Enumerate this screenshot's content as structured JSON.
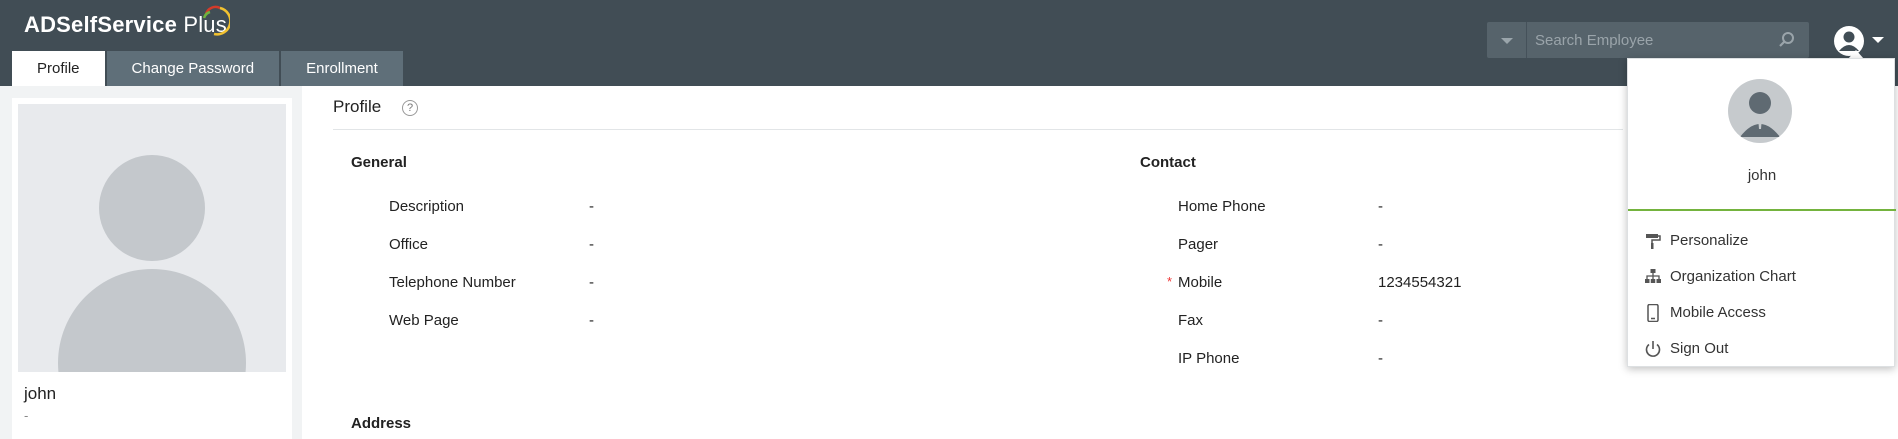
{
  "app": {
    "logo_text": "ADSelfService",
    "logo_plus": "Plus"
  },
  "tabs": [
    {
      "label": "Profile",
      "active": true
    },
    {
      "label": "Change Password",
      "active": false
    },
    {
      "label": "Enrollment",
      "active": false
    }
  ],
  "search": {
    "placeholder": "Search Employee",
    "value": ""
  },
  "profile_card": {
    "name": "john",
    "subtitle": "-"
  },
  "main": {
    "title": "Profile",
    "help_glyph": "?",
    "general": {
      "title": "General",
      "fields": [
        {
          "label": "Description",
          "value": "-"
        },
        {
          "label": "Office",
          "value": "-"
        },
        {
          "label": "Telephone Number",
          "value": "-"
        },
        {
          "label": "Web Page",
          "value": "-"
        }
      ]
    },
    "contact": {
      "title": "Contact",
      "fields": [
        {
          "label": "Home Phone",
          "value": "-",
          "required": false
        },
        {
          "label": "Pager",
          "value": "-",
          "required": false
        },
        {
          "label": "Mobile",
          "value": "1234554321",
          "required": true
        },
        {
          "label": "Fax",
          "value": "-",
          "required": false
        },
        {
          "label": "IP Phone",
          "value": "-",
          "required": false
        }
      ]
    },
    "address": {
      "title": "Address"
    },
    "required_marker": "*"
  },
  "user_menu": {
    "username": "john",
    "items": [
      {
        "label": "Personalize",
        "icon": "paint-roller-icon"
      },
      {
        "label": "Organization Chart",
        "icon": "org-chart-icon"
      },
      {
        "label": "Mobile Access",
        "icon": "mobile-icon"
      },
      {
        "label": "Sign Out",
        "icon": "power-icon"
      }
    ]
  },
  "colors": {
    "header_bg": "#414d55",
    "tab_bg": "#5f6f79",
    "accent_green": "#74b33e",
    "required_red": "#ee3333"
  }
}
